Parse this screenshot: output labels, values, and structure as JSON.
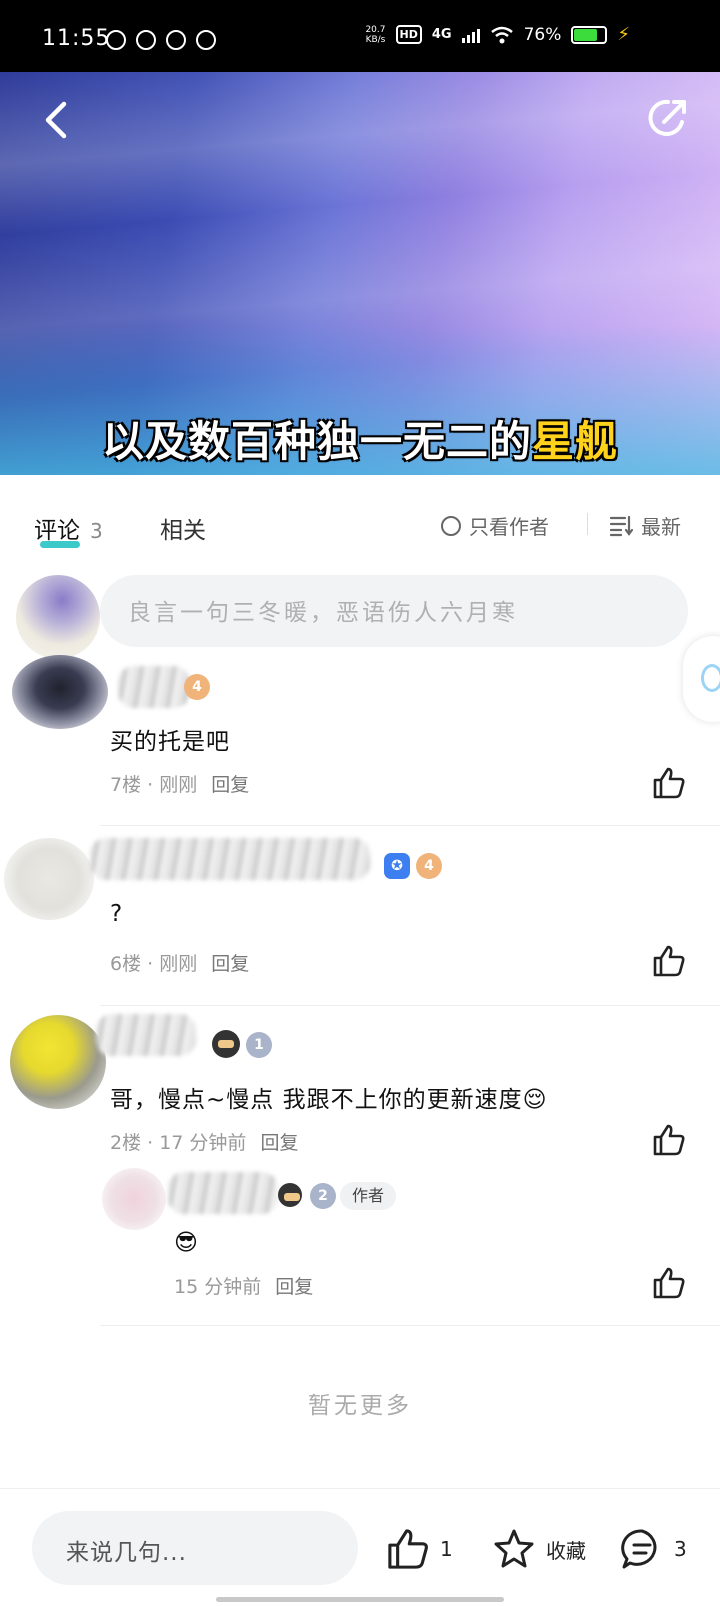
{
  "status_bar": {
    "time": "11:55",
    "net_speed_value": "20.7",
    "net_speed_unit": "KB/s",
    "hd": "HD",
    "network": "4G",
    "battery": "76%",
    "battery_level": 0.76
  },
  "video": {
    "subtitle_main": "以及数百种独一无二的",
    "subtitle_highlight": "星舰",
    "subtitle_highlight_color": "#ffd21c"
  },
  "tabs": {
    "comments_label": "评论",
    "comments_count": "3",
    "related_label": "相关",
    "only_author": "只看作者",
    "sort": "最新",
    "accent_color": "#3bc9c9"
  },
  "comment_input": {
    "placeholder": "良言一句三冬暖，恶语伤人六月寒"
  },
  "comments": [
    {
      "text": "买的托是吧",
      "floor": "7楼",
      "time": "刚刚",
      "reply": "回复",
      "level": "4"
    },
    {
      "text": "?",
      "floor": "6楼",
      "time": "刚刚",
      "reply": "回复",
      "level": "4"
    },
    {
      "text": "哥，慢点~慢点 我跟不上你的更新速度😌",
      "floor": "2楼",
      "time": "17 分钟前",
      "reply": "回复",
      "level": "1"
    }
  ],
  "sub_reply": {
    "level": "2",
    "author_tag": "作者",
    "text": "😎",
    "time": "15 分钟前",
    "reply": "回复"
  },
  "no_more": "暂无更多",
  "bottom_bar": {
    "input_placeholder": "来说几句...",
    "like_count": "1",
    "favorite_label": "收藏",
    "comment_count": "3"
  }
}
